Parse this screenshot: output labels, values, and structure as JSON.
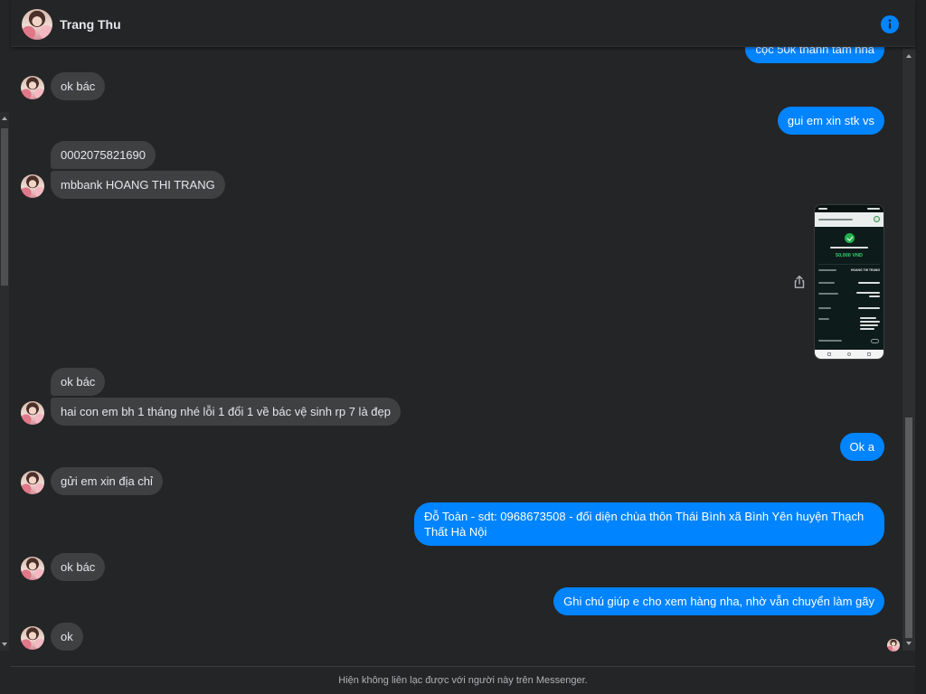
{
  "header": {
    "contact_name": "Trang Thu"
  },
  "icons": {
    "conversation_info": "info-icon",
    "share_attachment": "share-icon",
    "scroll_up": "arrow-up-icon",
    "scroll_down": "arrow-down-icon"
  },
  "colors": {
    "background": "#242526",
    "incoming_bubble": "#3e4042",
    "outgoing_bubble": "#0084ff",
    "text": "#e4e6eb",
    "secondary_text": "#b0b3b8",
    "accent": "#0084ff"
  },
  "conversation": {
    "messages": [
      {
        "outgoing": true,
        "text": "cọc 50k thanh tâm nha"
      },
      {
        "outgoing": false,
        "text": "ok bác"
      },
      {
        "outgoing": true,
        "text": "gui em xin stk vs"
      },
      {
        "outgoing": false,
        "text": "0002075821690"
      },
      {
        "outgoing": false,
        "text": "mbbank HOANG THI TRANG"
      },
      {
        "outgoing": true,
        "image_text": {
          "amount": "50,000 VND",
          "recipient": "HOANG THI TRANG"
        }
      },
      {
        "outgoing": false,
        "text": "ok bác"
      },
      {
        "outgoing": false,
        "text": "hai con em bh 1 tháng nhé lỗi 1 đổi 1 về bác vệ sinh rp 7 là đẹp"
      },
      {
        "outgoing": true,
        "text": "Ok a"
      },
      {
        "outgoing": false,
        "text": "gửi em xin địa chỉ"
      },
      {
        "outgoing": true,
        "text": "Đỗ Toàn - sdt: 0968673508 - đối diện chùa thôn Thái Bình xã Bình Yên huyện Thạch Thất Hà Nội"
      },
      {
        "outgoing": false,
        "text": "ok bác"
      },
      {
        "outgoing": true,
        "text": "Ghi chú giúp e cho xem hàng nha, nhờ vẫn chuyển làm gãy"
      },
      {
        "outgoing": false,
        "text": "ok"
      }
    ]
  },
  "footer": {
    "notice": "Hiện không liên lạc được với người này trên Messenger."
  }
}
